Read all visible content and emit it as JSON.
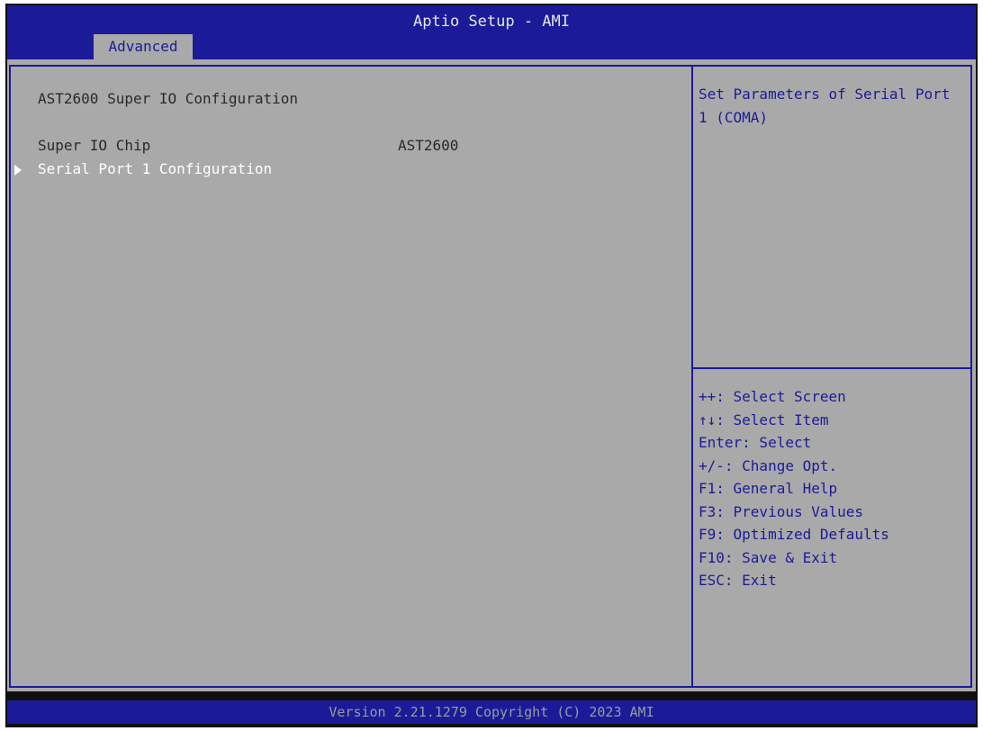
{
  "window": {
    "title": "Aptio Setup - AMI"
  },
  "tabs": [
    {
      "label": "Advanced",
      "active": true
    }
  ],
  "page": {
    "title": "AST2600 Super IO Configuration",
    "items": [
      {
        "label": "Super IO Chip",
        "value": "AST2600"
      },
      {
        "label": "Serial Port 1 Configuration",
        "selected": true,
        "submenu": true
      }
    ]
  },
  "help": {
    "text": "Set Parameters of Serial Port 1 (COMA)"
  },
  "keys": [
    "++: Select Screen",
    "↑↓: Select Item",
    "Enter: Select",
    "+/-: Change Opt.",
    "F1: General Help",
    "F3: Previous Values",
    "F9: Optimized Defaults",
    "F10: Save & Exit",
    "ESC: Exit"
  ],
  "footer": {
    "text": "Version 2.21.1279 Copyright (C) 2023 AMI"
  },
  "colors": {
    "header_blue": "#1b1b9a",
    "panel_gray": "#a9a9a9",
    "selected_text": "#ffffff",
    "help_text": "#1b1b9a"
  }
}
